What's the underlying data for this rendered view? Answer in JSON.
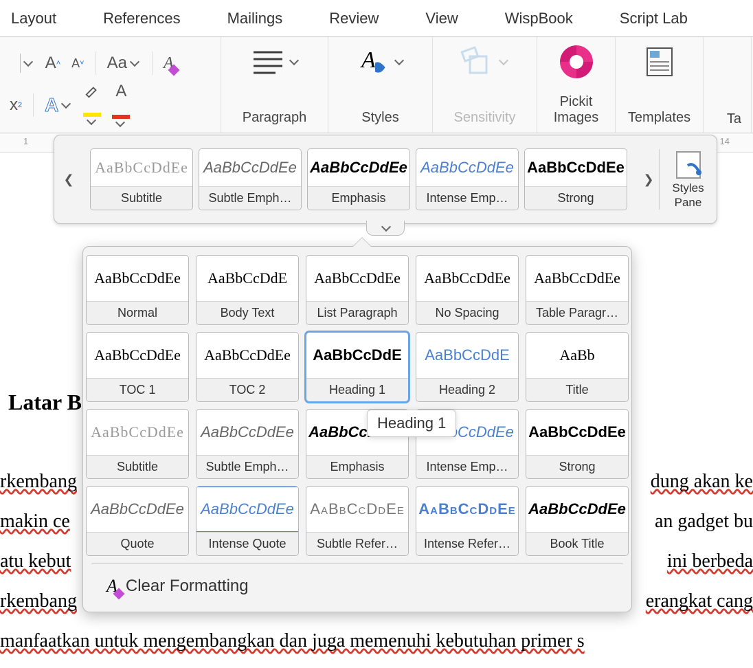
{
  "tabs": [
    "Layout",
    "References",
    "Mailings",
    "Review",
    "View",
    "WispBook",
    "Script Lab"
  ],
  "groups": {
    "paragraph": "Paragraph",
    "styles": "Styles",
    "sensitivity": "Sensitivity",
    "pickit": "Pickit Images",
    "templates": "Templates",
    "table_views": "Ta"
  },
  "strip": {
    "items": [
      {
        "label": "Subtitle",
        "preview": "AaBbCcDdEe",
        "cls": "pv-subtitle"
      },
      {
        "label": "Subtle Emph…",
        "preview": "AaBbCcDdEe",
        "cls": "pv-subemph"
      },
      {
        "label": "Emphasis",
        "preview": "AaBbCcDdEe",
        "cls": "pv-emph"
      },
      {
        "label": "Intense Emp…",
        "preview": "AaBbCcDdEe",
        "cls": "pv-intemph"
      },
      {
        "label": "Strong",
        "preview": "AaBbCcDdEe",
        "cls": "pv-strong"
      }
    ],
    "pane_label1": "Styles",
    "pane_label2": "Pane"
  },
  "gallery": {
    "items": [
      {
        "label": "Normal",
        "preview": "AaBbCcDdEe",
        "cls": "pv-normal"
      },
      {
        "label": "Body Text",
        "preview": "AaBbCcDdE",
        "cls": "pv-normal"
      },
      {
        "label": "List Paragraph",
        "preview": "AaBbCcDdEe",
        "cls": "pv-normal"
      },
      {
        "label": "No Spacing",
        "preview": "AaBbCcDdEe",
        "cls": "pv-normal"
      },
      {
        "label": "Table Paragr…",
        "preview": "AaBbCcDdEe",
        "cls": "pv-normal"
      },
      {
        "label": "TOC 1",
        "preview": "AaBbCcDdEe",
        "cls": "pv-normal"
      },
      {
        "label": "TOC 2",
        "preview": "AaBbCcDdEe",
        "cls": "pv-normal"
      },
      {
        "label": "Heading 1",
        "preview": "AaBbCcDdE",
        "cls": "pv-heading1",
        "selected": true
      },
      {
        "label": "Heading 2",
        "preview": "AaBbCcDdE",
        "cls": "pv-heading2"
      },
      {
        "label": "Title",
        "preview": "AaBb",
        "cls": "pv-title"
      },
      {
        "label": "Subtitle",
        "preview": "AaBbCcDdEe",
        "cls": "pv-subtitle"
      },
      {
        "label": "Subtle Emph…",
        "preview": "AaBbCcDdEe",
        "cls": "pv-subemph"
      },
      {
        "label": "Emphasis",
        "preview": "AaBbCcDdEe",
        "cls": "pv-emph"
      },
      {
        "label": "Intense Emp…",
        "preview": "AaBbCcDdEe",
        "cls": "pv-intemph"
      },
      {
        "label": "Strong",
        "preview": "AaBbCcDdEe",
        "cls": "pv-strong"
      },
      {
        "label": "Quote",
        "preview": "AaBbCcDdEe",
        "cls": "pv-quote"
      },
      {
        "label": "Intense Quote",
        "preview": "AaBbCcDdEe",
        "cls": "pv-intquote"
      },
      {
        "label": "Subtle Refer…",
        "preview": "AaBbCcDdEe",
        "cls": "pv-subref"
      },
      {
        "label": "Intense Refer…",
        "preview": "AaBbCcDdEe",
        "cls": "pv-intref"
      },
      {
        "label": "Book Title",
        "preview": "AaBbCcDdEe",
        "cls": "pv-booktitle"
      }
    ],
    "clear": "Clear Formatting"
  },
  "tooltip": "Heading 1",
  "ruler": {
    "left_num": "1",
    "right_num": "14"
  },
  "document": {
    "heading": "Latar B",
    "line1_left": "rkembang",
    "line1_right": "dung  akan  ke",
    "line2_left": "makin  ce",
    "line2_right": "an  gadget  bu",
    "line3_left": "atu  kebut",
    "line3_right": "  ini   berbeda",
    "line4_left": "rkembang",
    "line4_right": "erangkat cang",
    "line5": "manfaatkan   untuk   mengembangkan   dan   juga   memenuhi   kebutuhan   primer   s"
  }
}
